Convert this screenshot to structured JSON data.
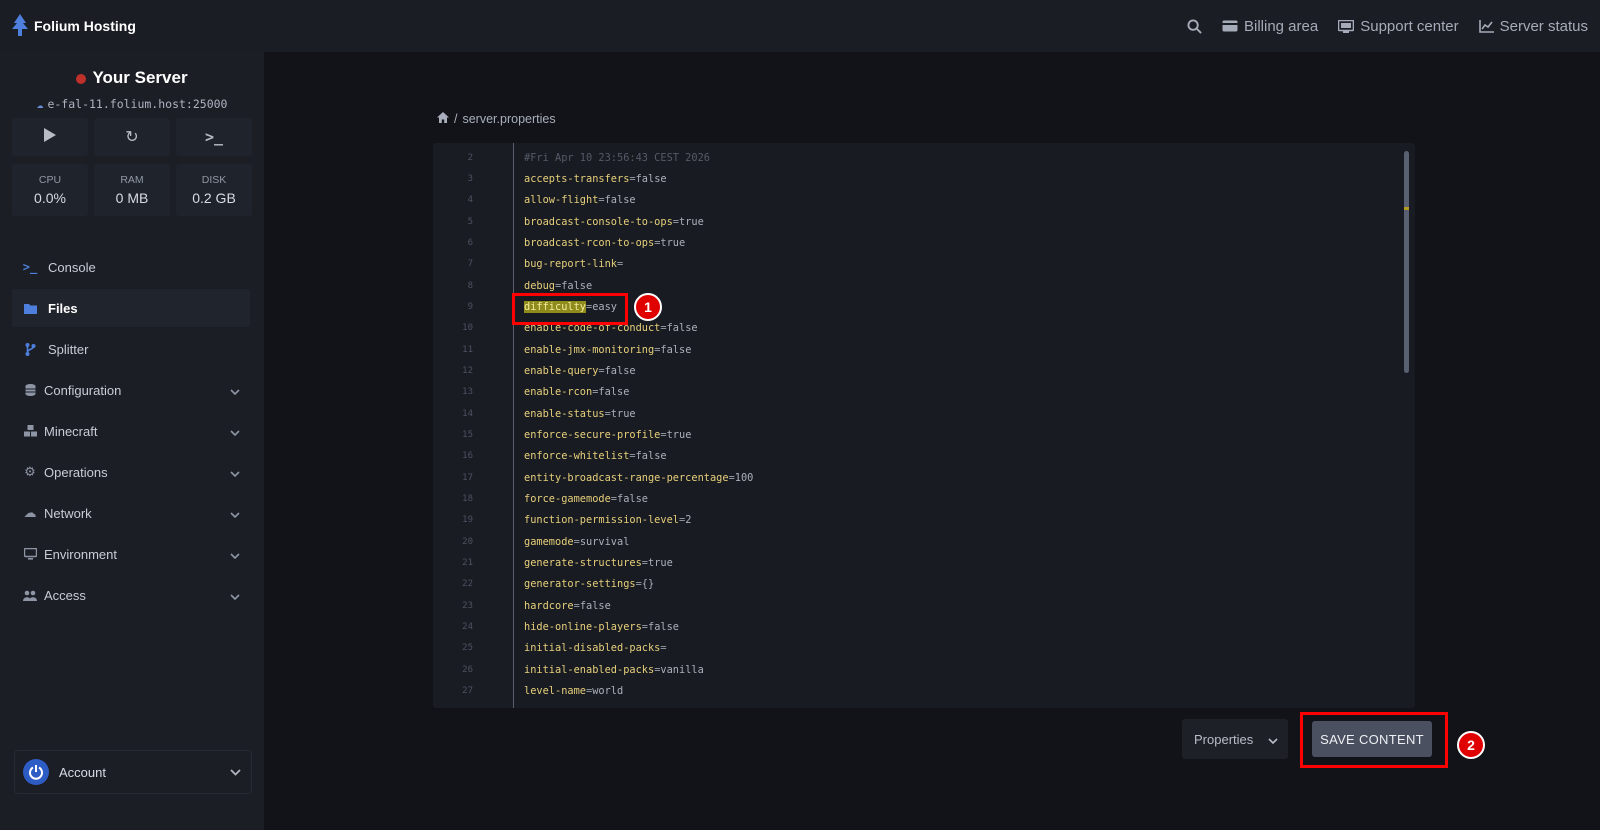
{
  "brand": {
    "name": "Folium Hosting"
  },
  "topnav": [
    {
      "label": "Billing area",
      "icon": "credit-card-icon"
    },
    {
      "label": "Support center",
      "icon": "monitor-icon"
    },
    {
      "label": "Server status",
      "icon": "chart-icon"
    }
  ],
  "server": {
    "title": "Your Server",
    "host": "e-fal-11.folium.host:25000",
    "status_color": "#c0302b",
    "stats": [
      {
        "label": "CPU",
        "value": "0.0%"
      },
      {
        "label": "RAM",
        "value": "0 MB"
      },
      {
        "label": "DISK",
        "value": "0.2 GB"
      }
    ]
  },
  "sidebar": {
    "items": [
      {
        "label": "Console",
        "icon": "terminal-icon"
      },
      {
        "label": "Files",
        "icon": "folder-icon",
        "active": true
      },
      {
        "label": "Splitter",
        "icon": "branch-icon"
      },
      {
        "label": "Configuration",
        "icon": "database-icon"
      },
      {
        "label": "Minecraft",
        "icon": "cubes-icon"
      },
      {
        "label": "Operations",
        "icon": "gear-icon"
      },
      {
        "label": "Network",
        "icon": "cloud-icon"
      },
      {
        "label": "Environment",
        "icon": "desktop-icon"
      },
      {
        "label": "Access",
        "icon": "users-icon"
      }
    ],
    "account_label": "Account"
  },
  "breadcrumb": {
    "separator": "/",
    "file": "server.properties"
  },
  "editor": {
    "lines": [
      {
        "n": "2",
        "comment": "#Fri Apr 10 23:56:43 CEST 2026"
      },
      {
        "n": "3",
        "key": "accepts-transfers",
        "value": "false"
      },
      {
        "n": "4",
        "key": "allow-flight",
        "value": "false"
      },
      {
        "n": "5",
        "key": "broadcast-console-to-ops",
        "value": "true"
      },
      {
        "n": "6",
        "key": "broadcast-rcon-to-ops",
        "value": "true"
      },
      {
        "n": "7",
        "key": "bug-report-link",
        "value": ""
      },
      {
        "n": "8",
        "key": "debug",
        "value": "false"
      },
      {
        "n": "9",
        "key": "difficulty",
        "value": "easy",
        "highlight": true
      },
      {
        "n": "10",
        "key": "enable-code-of-conduct",
        "value": "false"
      },
      {
        "n": "11",
        "key": "enable-jmx-monitoring",
        "value": "false"
      },
      {
        "n": "12",
        "key": "enable-query",
        "value": "false"
      },
      {
        "n": "13",
        "key": "enable-rcon",
        "value": "false"
      },
      {
        "n": "14",
        "key": "enable-status",
        "value": "true"
      },
      {
        "n": "15",
        "key": "enforce-secure-profile",
        "value": "true"
      },
      {
        "n": "16",
        "key": "enforce-whitelist",
        "value": "false"
      },
      {
        "n": "17",
        "key": "entity-broadcast-range-percentage",
        "value": "100"
      },
      {
        "n": "18",
        "key": "force-gamemode",
        "value": "false"
      },
      {
        "n": "19",
        "key": "function-permission-level",
        "value": "2"
      },
      {
        "n": "20",
        "key": "gamemode",
        "value": "survival"
      },
      {
        "n": "21",
        "key": "generate-structures",
        "value": "true"
      },
      {
        "n": "22",
        "key": "generator-settings",
        "value": "{}"
      },
      {
        "n": "23",
        "key": "hardcore",
        "value": "false"
      },
      {
        "n": "24",
        "key": "hide-online-players",
        "value": "false"
      },
      {
        "n": "25",
        "key": "initial-disabled-packs",
        "value": ""
      },
      {
        "n": "26",
        "key": "initial-enabled-packs",
        "value": "vanilla"
      },
      {
        "n": "27",
        "key": "level-name",
        "value": "world"
      }
    ]
  },
  "footer": {
    "mode_select": "Properties",
    "save_label": "SAVE CONTENT"
  },
  "annotations": [
    {
      "number": "1"
    },
    {
      "number": "2"
    }
  ],
  "colors": {
    "accent_blue": "#2d5cc5",
    "annotation_red": "#ff0000",
    "highlight": "#8f8b1d"
  }
}
